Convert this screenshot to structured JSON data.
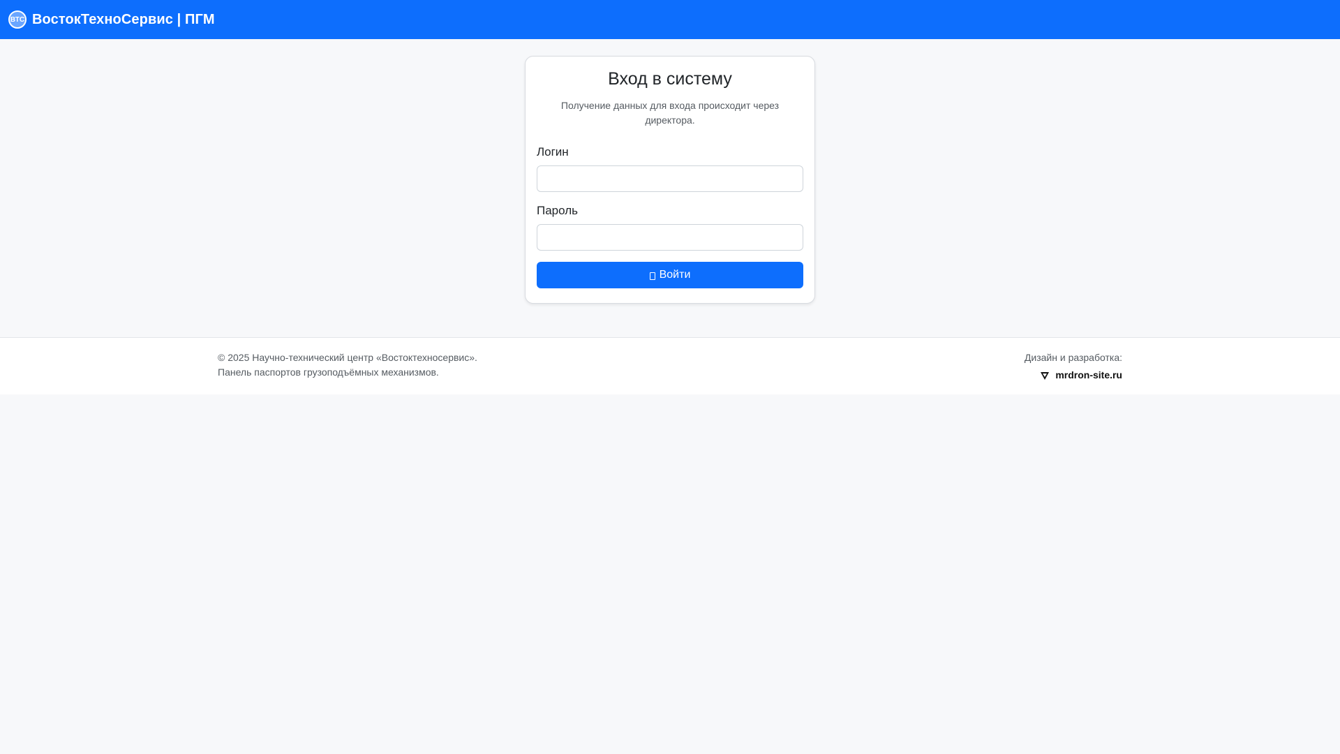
{
  "header": {
    "brand_title": "ВостокТехноСервис | ПГМ",
    "logo_text": "ВТС",
    "accent_color": "#0d6efd"
  },
  "login": {
    "title": "Вход в систему",
    "subtitle": "Получение данных для входа происходит через директора.",
    "login_label": "Логин",
    "login_value": "",
    "password_label": "Пароль",
    "password_value": "",
    "submit_label": "Войти",
    "submit_icon": "login-icon"
  },
  "footer": {
    "copyright_line": "© 2025 Научно-технический центр «Востоктехносервис».",
    "description_line": "Панель паспортов грузоподъёмных механизмов.",
    "developer_caption": "Дизайн и разработка:",
    "developer_link": "mrdron-site.ru",
    "developer_icon": "mrdron-logo-icon"
  }
}
